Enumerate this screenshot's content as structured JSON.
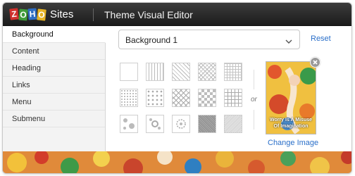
{
  "header": {
    "logo_letters": [
      "Z",
      "O",
      "H",
      "O"
    ],
    "logo_suffix": "Sites",
    "title": "Theme Visual Editor"
  },
  "sidebar": {
    "items": [
      {
        "label": "Background",
        "active": true
      },
      {
        "label": "Content",
        "active": false
      },
      {
        "label": "Heading",
        "active": false
      },
      {
        "label": "Links",
        "active": false
      },
      {
        "label": "Menu",
        "active": false
      },
      {
        "label": "Submenu",
        "active": false
      }
    ]
  },
  "main": {
    "dropdown_value": "Background 1",
    "reset_label": "Reset",
    "or_label": "or",
    "thumbnail_caption_line1": "Worry Is A Misuse",
    "thumbnail_caption_line2": "Of Imagination",
    "change_image_label": "Change Image"
  },
  "icons": {
    "dropdown": "chevron-down-icon",
    "remove_image": "close-icon"
  },
  "colors": {
    "header_bg": "#2a2a2a",
    "link": "#2a6fc9",
    "sidebar_bg": "#f3f3f3"
  }
}
